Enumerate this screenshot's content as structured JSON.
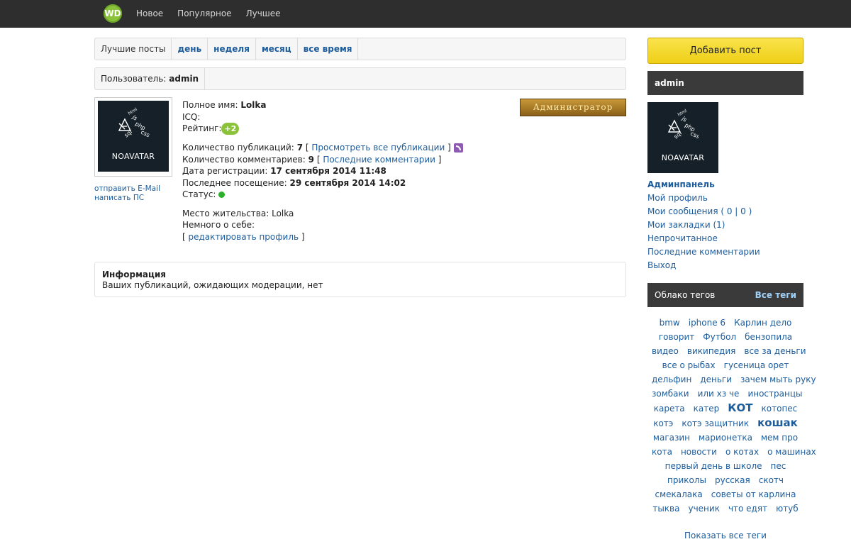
{
  "topbar": {
    "logo_text": "WD",
    "nav": [
      "Новое",
      "Популярное",
      "Лучшее"
    ]
  },
  "tabs": {
    "label": "Лучшие посты",
    "items": [
      "день",
      "неделя",
      "месяц",
      "все время"
    ]
  },
  "userbar": {
    "label": "Пользователь:",
    "username": "admin"
  },
  "avatar": {
    "text": "NOAVATAR",
    "doodle_labels": [
      "js",
      "php",
      "css",
      "sql",
      "html"
    ]
  },
  "profile_links": {
    "email": "отправить E-Mail",
    "pm": "написать ПС"
  },
  "profile": {
    "fullname_label": "Полное имя:",
    "fullname": "Lolka",
    "icq_label": "ICQ:",
    "rating_label": "Рейтинг:",
    "rating": "+2",
    "pubs_label": "Количество публикаций:",
    "pubs_count": "7",
    "pubs_link": "Просмотреть все публикации",
    "comments_label": "Количество комментариев:",
    "comments_count": "9",
    "comments_link": "Последние комментарии",
    "reg_label": "Дата регистрации:",
    "reg_date": "17 сентября 2014 11:48",
    "last_label": "Последнее посещение:",
    "last_date": "29 сентября 2014 14:02",
    "status_label": "Статус:",
    "status_color": "#2bb02b",
    "location_label": "Место жительства:",
    "location": "Lolka",
    "about_label": "Немного о себе:",
    "edit_link": "редактировать профиль",
    "group_badge": "Администратор"
  },
  "infobox": {
    "title": "Информация",
    "text": "Ваших публикаций, ожидающих модерации, нет"
  },
  "sidebar": {
    "add_post": "Добавить пост",
    "user_title": "admin",
    "links": {
      "adminpanel": "Админпанель",
      "profile": "Мой профиль",
      "messages": "Мои сообщения ( 0 | 0 )",
      "bookmarks": "Мои закладки (1)",
      "unread": "Непрочитанное",
      "last_comments": "Последние комментарии",
      "logout": "Выход"
    },
    "tags_title": "Облако тегов",
    "tags_all": "Все теги",
    "tag_lines": [
      [
        "bmw",
        "iphone 6",
        "Карлин дело"
      ],
      [
        "говорит",
        "Футбол",
        "бензопила"
      ],
      [
        "видео",
        "википедия",
        "все за деньги"
      ],
      [
        "все о рыбах",
        "гусеница орет"
      ],
      [
        "дельфин",
        "деньги",
        "зачем мыть руку"
      ],
      [
        "зомбаки",
        "или хз че",
        "иностранцы"
      ],
      [
        "карета",
        "катер",
        "КОТ",
        "котопес"
      ],
      [
        "котэ",
        "котэ защитник",
        "кошак"
      ],
      [
        "магазин",
        "марионетка",
        "мем про"
      ],
      [
        "кота",
        "новости",
        "о котах",
        "о машинах"
      ],
      [
        "первый день в школе",
        "пес"
      ],
      [
        "приколы",
        "русская",
        "скотч"
      ],
      [
        "смекалака",
        "советы от карлина"
      ],
      [
        "тыква",
        "ученик",
        "что едят",
        "ютуб"
      ]
    ],
    "show_all_tags": "Показать все теги"
  }
}
